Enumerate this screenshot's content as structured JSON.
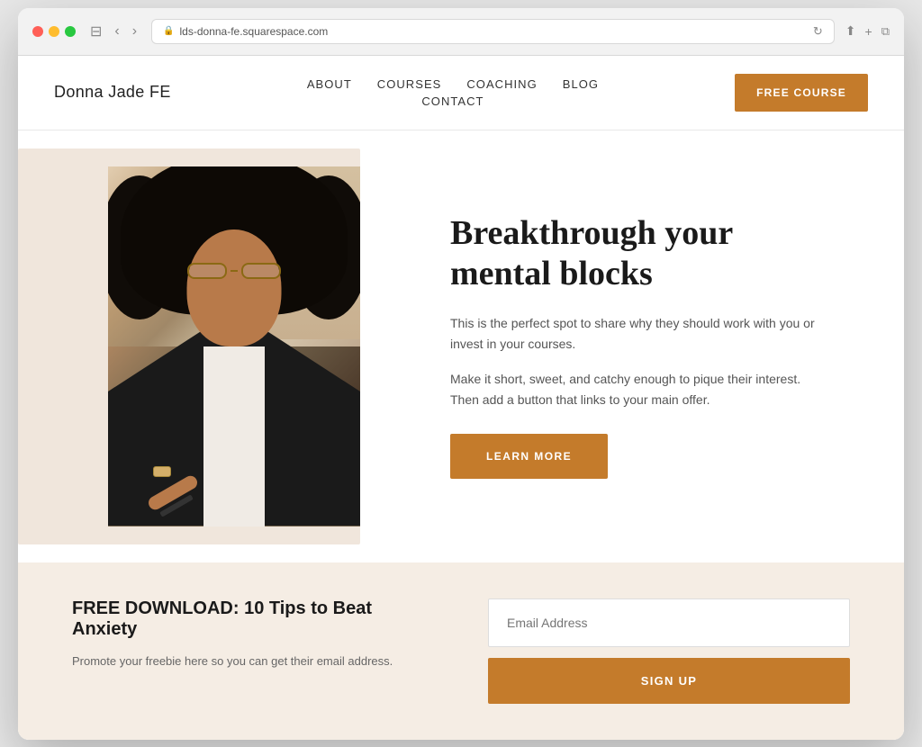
{
  "browser": {
    "url": "lds-donna-fe.squarespace.com",
    "back_label": "‹",
    "forward_label": "›"
  },
  "header": {
    "logo": "Donna Jade FE",
    "nav": {
      "about": "ABOUT",
      "courses": "COURSES",
      "coaching": "COACHING",
      "blog": "BLOG",
      "contact": "CONTACT"
    },
    "cta_label": "FREE COURSE"
  },
  "hero": {
    "headline": "Breakthrough your mental blocks",
    "body1": "This is the perfect spot to share why they should work with you or invest in your courses.",
    "body2": "Make it short, sweet, and catchy enough to pique their interest. Then add a button that links to your main offer.",
    "cta_label": "LEARN MORE"
  },
  "email_section": {
    "title": "FREE DOWNLOAD: 10 Tips to Beat Anxiety",
    "description": "Promote your freebie here so you can get their email address.",
    "input_placeholder": "Email Address",
    "signup_label": "SIGN UP"
  },
  "colors": {
    "accent": "#c47b2b",
    "bg_warm": "#f5ede4",
    "bg_hero_block": "#f0e6dc"
  }
}
